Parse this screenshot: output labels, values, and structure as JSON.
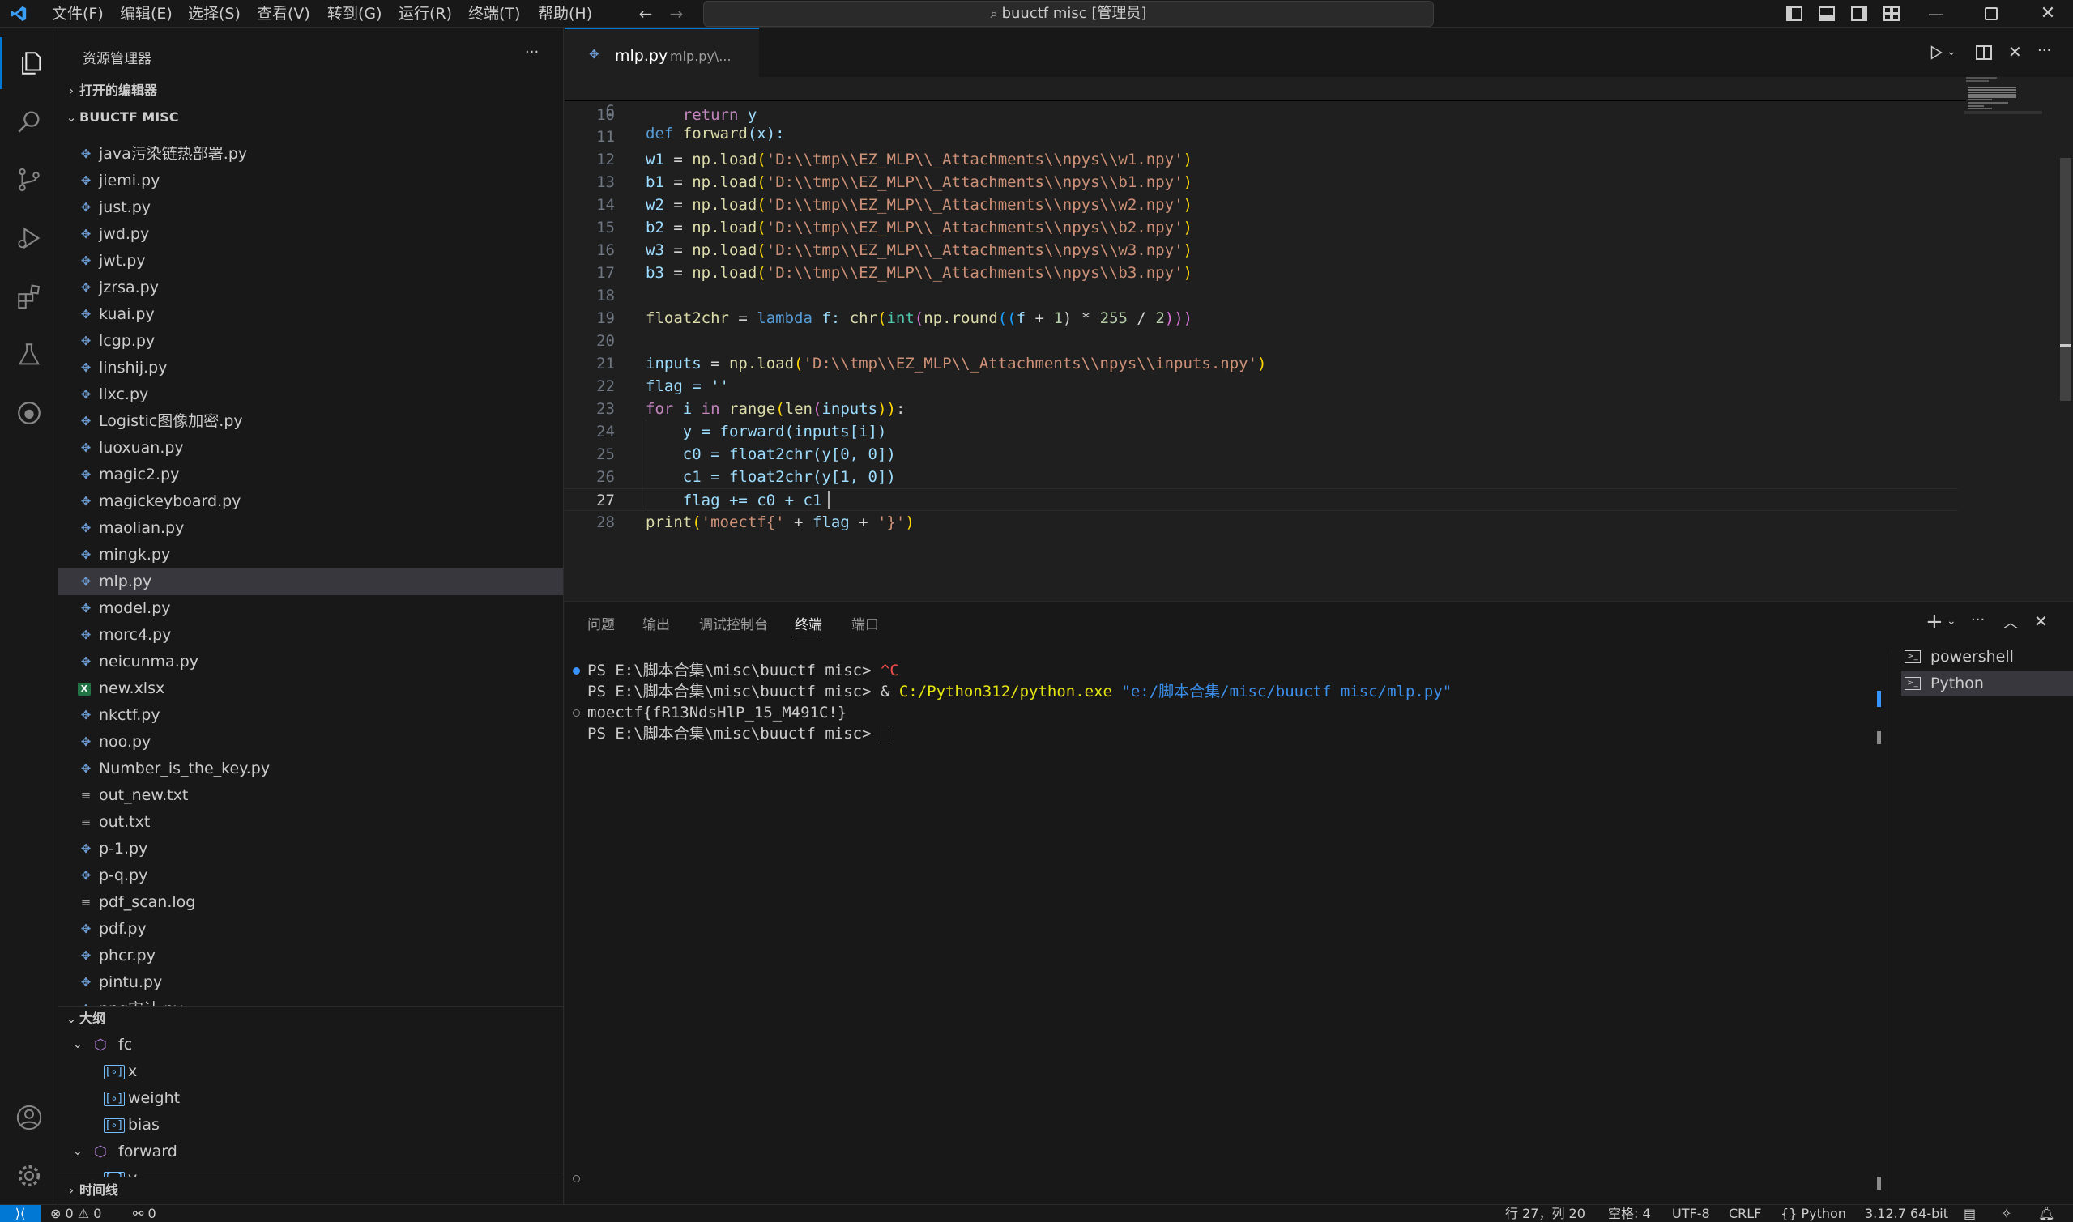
{
  "titlebar": {
    "menus": [
      "文件(F)",
      "编辑(E)",
      "选择(S)",
      "查看(V)",
      "转到(G)",
      "运行(R)",
      "终端(T)",
      "帮助(H)"
    ],
    "search_text": "buuctf misc [管理员]"
  },
  "sidebar": {
    "title": "资源管理器",
    "open_editors": "打开的编辑器",
    "folder": "BUUCTF MISC",
    "files": [
      "java污染链热部署.py",
      "jiemi.py",
      "just.py",
      "jwd.py",
      "jwt.py",
      "jzrsa.py",
      "kuai.py",
      "lcgp.py",
      "linshij.py",
      "llxc.py",
      "Logistic图像加密.py",
      "luoxuan.py",
      "magic2.py",
      "magickeyboard.py",
      "maolian.py",
      "mingk.py",
      "mlp.py",
      "model.py",
      "morc4.py",
      "neicunma.py",
      "new.xlsx",
      "nkctf.py",
      "noo.py",
      "Number_is_the_key.py",
      "out_new.txt",
      "out.txt",
      "p-1.py",
      "p-q.py",
      "pdf_scan.log",
      "pdf.py",
      "phcr.py",
      "pintu.py",
      "png审计.py"
    ],
    "outline_title": "大纲",
    "outline": {
      "class1": "fc",
      "class1_children": [
        "x",
        "weight",
        "bias"
      ],
      "class2": "forward",
      "class2_child": "y"
    },
    "timeline_title": "时间线"
  },
  "editor": {
    "tab_name": "mlp.py",
    "tab_path": "mlp.py\\...",
    "sticky_line_no": "6",
    "line_numbers": [
      "10",
      "11",
      "12",
      "13",
      "14",
      "15",
      "16",
      "17",
      "18",
      "19",
      "20",
      "21",
      "22",
      "23",
      "24",
      "25",
      "26",
      "27",
      "28"
    ],
    "sticky": {
      "def": "def",
      "name": "forward",
      "rest": "(x):"
    },
    "code": {
      "l10_kw": "return",
      "l10_var": "y",
      "loads": [
        {
          "var": "w1",
          "path": "'D:\\\\tmp\\\\EZ_MLP\\\\_Attachments\\\\npys\\\\w1.npy'"
        },
        {
          "var": "b1",
          "path": "'D:\\\\tmp\\\\EZ_MLP\\\\_Attachments\\\\npys\\\\b1.npy'"
        },
        {
          "var": "w2",
          "path": "'D:\\\\tmp\\\\EZ_MLP\\\\_Attachments\\\\npys\\\\w2.npy'"
        },
        {
          "var": "b2",
          "path": "'D:\\\\tmp\\\\EZ_MLP\\\\_Attachments\\\\npys\\\\b2.npy'"
        },
        {
          "var": "w3",
          "path": "'D:\\\\tmp\\\\EZ_MLP\\\\_Attachments\\\\npys\\\\w3.npy'"
        },
        {
          "var": "b3",
          "path": "'D:\\\\tmp\\\\EZ_MLP\\\\_Attachments\\\\npys\\\\b3.npy'"
        }
      ],
      "np_load": "np.load",
      "float2chr_line": [
        "float2chr",
        " = ",
        "lambda",
        " f: ",
        "chr",
        "(",
        "int",
        "(",
        "np.round",
        "((",
        "f",
        " + ",
        "1",
        ") * ",
        "255",
        " / ",
        "2",
        ")))"
      ],
      "inputs_var": "inputs",
      "inputs_path": "'D:\\\\tmp\\\\EZ_MLP\\\\_Attachments\\\\npys\\\\inputs.npy'",
      "flag_line": "flag = ''",
      "for_line": [
        "for",
        " i ",
        "in",
        " ",
        "range",
        "(",
        "len",
        "(",
        "inputs",
        "))",
        ":"
      ],
      "l24": "y = forward(inputs[i])",
      "l25": "c0 = float2chr(y[0, 0])",
      "l26": "c1 = float2chr(y[1, 0])",
      "l27": "flag += c0 + c1",
      "l28_fn": "print",
      "l28_rest": [
        "(",
        "'moectf{'",
        " + ",
        "flag",
        " + ",
        "'}'",
        ")"
      ]
    }
  },
  "panel": {
    "tabs": [
      "问题",
      "输出",
      "调试控制台",
      "终端",
      "端口"
    ],
    "active_tab": "终端",
    "terminal": {
      "line1_prompt": "PS E:\\脚本合集\\misc\\buuctf misc> ",
      "line1_cmd": "^C",
      "line2_prompt": "PS E:\\脚本合集\\misc\\buuctf misc> & ",
      "line2_exe": "C:/Python312/python.exe",
      "line2_arg": " \"e:/脚本合集/misc/buuctf misc/mlp.py\"",
      "line3": "moectf{fR13NdsHlP_15_M491C!}",
      "line4_prompt": "PS E:\\脚本合集\\misc\\buuctf misc> "
    },
    "terminals": [
      "powershell",
      "Python"
    ]
  },
  "statusbar": {
    "errors": "0",
    "warnings": "0",
    "ports": "0",
    "position": "行 27，列 20",
    "spaces": "空格: 4",
    "encoding": "UTF-8",
    "eol": "CRLF",
    "language": "Python",
    "interpreter": "3.12.7 64-bit"
  },
  "colors": {
    "accent": "#0078d4",
    "bg": "#1f1f1f",
    "sidebar": "#181818"
  }
}
